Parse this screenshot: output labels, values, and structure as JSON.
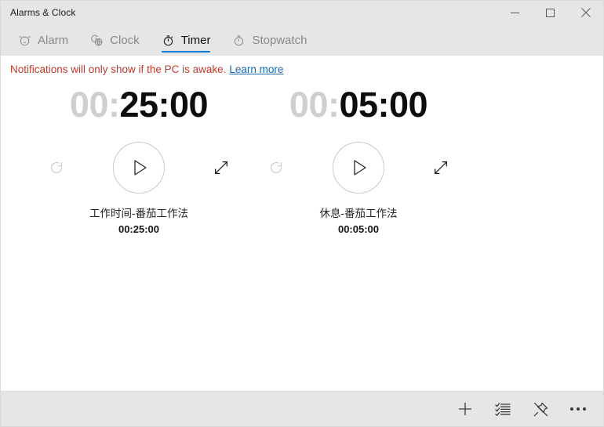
{
  "window": {
    "title": "Alarms & Clock",
    "controls": [
      {
        "name": "minimize-button",
        "icon": "minimize-icon",
        "label": "Minimize"
      },
      {
        "name": "maximize-button",
        "icon": "maximize-icon",
        "label": "Maximize"
      },
      {
        "name": "close-button",
        "icon": "close-icon",
        "label": "Close"
      }
    ]
  },
  "tabs": [
    {
      "label": "Alarm",
      "icon": "alarm-clock-icon",
      "active": false
    },
    {
      "label": "Clock",
      "icon": "world-clock-icon",
      "active": false
    },
    {
      "label": "Timer",
      "icon": "timer-icon",
      "active": true
    },
    {
      "label": "Stopwatch",
      "icon": "stopwatch-icon",
      "active": false
    }
  ],
  "notice": {
    "text": "Notifications will only show if the PC is awake.",
    "link_label": "Learn more",
    "text_color": "#c0392b",
    "link_color": "#1469b4"
  },
  "accent_color": "#0078d4",
  "timers": [
    {
      "dim_prefix": "00:",
      "lit_time": "25:00",
      "label": "工作时间-番茄工作法",
      "duration": "00:25:00",
      "reset_icon": "reset-icon",
      "play_icon": "play-icon",
      "expand_icon": "expand-icon"
    },
    {
      "dim_prefix": "00:",
      "lit_time": "05:00",
      "label": "休息-番茄工作法",
      "duration": "00:05:00",
      "reset_icon": "reset-icon",
      "play_icon": "play-icon",
      "expand_icon": "expand-icon"
    }
  ],
  "commandbar": [
    {
      "name": "add-timer-button",
      "icon": "plus-icon",
      "label": "New"
    },
    {
      "name": "edit-timers-button",
      "icon": "edit-list-icon",
      "label": "Edit"
    },
    {
      "name": "unpin-button",
      "icon": "unpin-icon",
      "label": "Unpin"
    },
    {
      "name": "more-options-button",
      "icon": "ellipsis-icon",
      "label": "See more"
    }
  ]
}
